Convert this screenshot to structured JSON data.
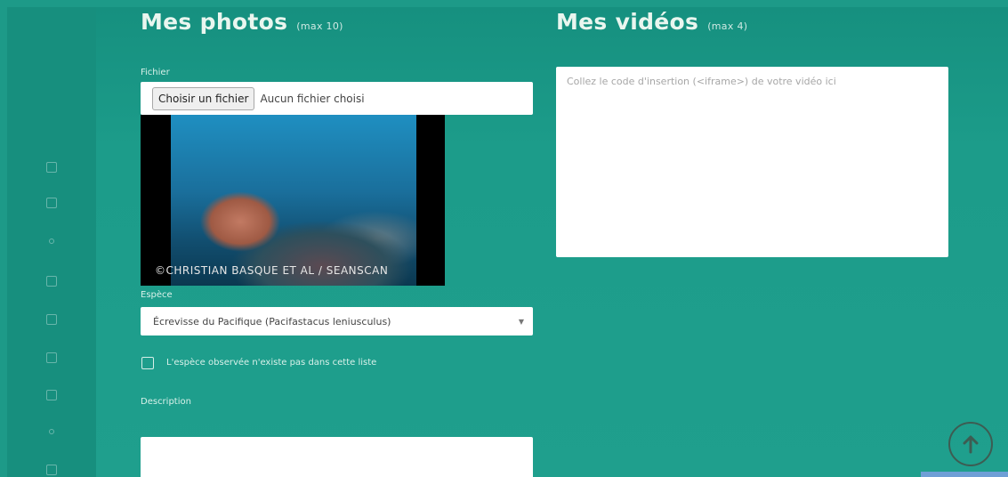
{
  "photos": {
    "title": "Mes photos",
    "max_note": "(max 10)",
    "file_label": "Fichier",
    "choose_file_label": "Choisir un fichier",
    "no_file_text": "Aucun fichier choisi",
    "photo_credit": "©CHRISTIAN BASQUE ET AL / SEANSCAN",
    "species_label": "Espèce",
    "species_value": "Écrevisse du Pacifique (Pacifastacus leniusculus)",
    "not_listed_label": "L'espèce observée n'existe pas dans cette liste",
    "description_label": "Description",
    "description_value": ""
  },
  "videos": {
    "title": "Mes vidéos",
    "max_note": "(max 4)",
    "placeholder": "Collez le code d'insertion (<iframe>) de votre vidéo ici"
  },
  "colors": {
    "background": "#1d9a88",
    "title_text": "#e9f6ef"
  },
  "icons": {
    "scroll_top": "arrow-up-circle-icon",
    "select_caret": "chevron-down-icon"
  }
}
